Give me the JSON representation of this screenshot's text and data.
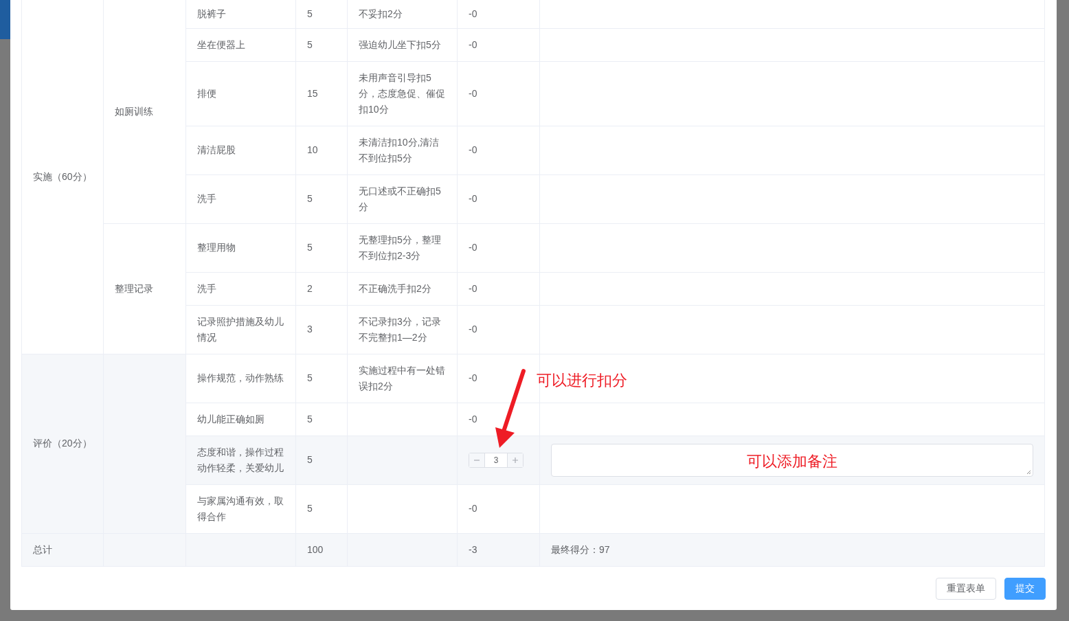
{
  "table": {
    "groups": [
      {
        "name": "实施（60分）",
        "subgroups": [
          {
            "name": "如厕训练",
            "items": [
              {
                "kind": "text",
                "item": "脱裤子",
                "points": "5",
                "criteria": "不妥扣2分",
                "deduction": "-0"
              },
              {
                "kind": "text",
                "item": "坐在便器上",
                "points": "5",
                "criteria": "强迫幼儿坐下扣5分",
                "deduction": "-0"
              },
              {
                "kind": "text",
                "item": "排便",
                "points": "15",
                "criteria": "未用声音引导扣5分，态度急促、催促扣10分",
                "deduction": "-0"
              },
              {
                "kind": "text",
                "item": "清洁屁股",
                "points": "10",
                "criteria": "未清洁扣10分,清洁不到位扣5分",
                "deduction": "-0"
              },
              {
                "kind": "text",
                "item": "洗手",
                "points": "5",
                "criteria": "无口述或不正确扣5分",
                "deduction": "-0"
              }
            ]
          },
          {
            "name": "整理记录",
            "items": [
              {
                "kind": "text",
                "item": "整理用物",
                "points": "5",
                "criteria": "无整理扣5分，整理不到位扣2-3分",
                "deduction": "-0"
              },
              {
                "kind": "text",
                "item": "洗手",
                "points": "2",
                "criteria": "不正确洗手扣2分",
                "deduction": "-0"
              },
              {
                "kind": "text",
                "item": "记录照护措施及幼儿情况",
                "points": "3",
                "criteria": "不记录扣3分，记录不完整扣1—2分",
                "deduction": "-0"
              }
            ]
          }
        ]
      },
      {
        "name": "评价（20分）",
        "subgroups": [
          {
            "items": [
              {
                "kind": "text",
                "item": "操作规范，动作熟练",
                "points": "5",
                "criteria": "实施过程中有一处错误扣2分",
                "deduction": "-0"
              },
              {
                "kind": "text",
                "item": "幼儿能正确如厕",
                "points": "5",
                "deduction": "-0"
              },
              {
                "kind": "stepper",
                "item": "态度和谐，操作过程动作轻柔，关爱幼儿",
                "points": "5",
                "value": "3",
                "remark_callout": "可以添加备注"
              },
              {
                "kind": "text",
                "item": "与家属沟通有效，取得合作",
                "points": "5",
                "deduction": "-0"
              }
            ]
          }
        ]
      }
    ],
    "total": {
      "label": "总计",
      "points": "100",
      "deduction": "-3",
      "final": "最终得分：97"
    }
  },
  "arrow_callout": "可以进行扣分",
  "buttons": [
    {
      "kind": "default",
      "label": "重置表单"
    },
    {
      "kind": "primary",
      "label": "提交"
    }
  ]
}
